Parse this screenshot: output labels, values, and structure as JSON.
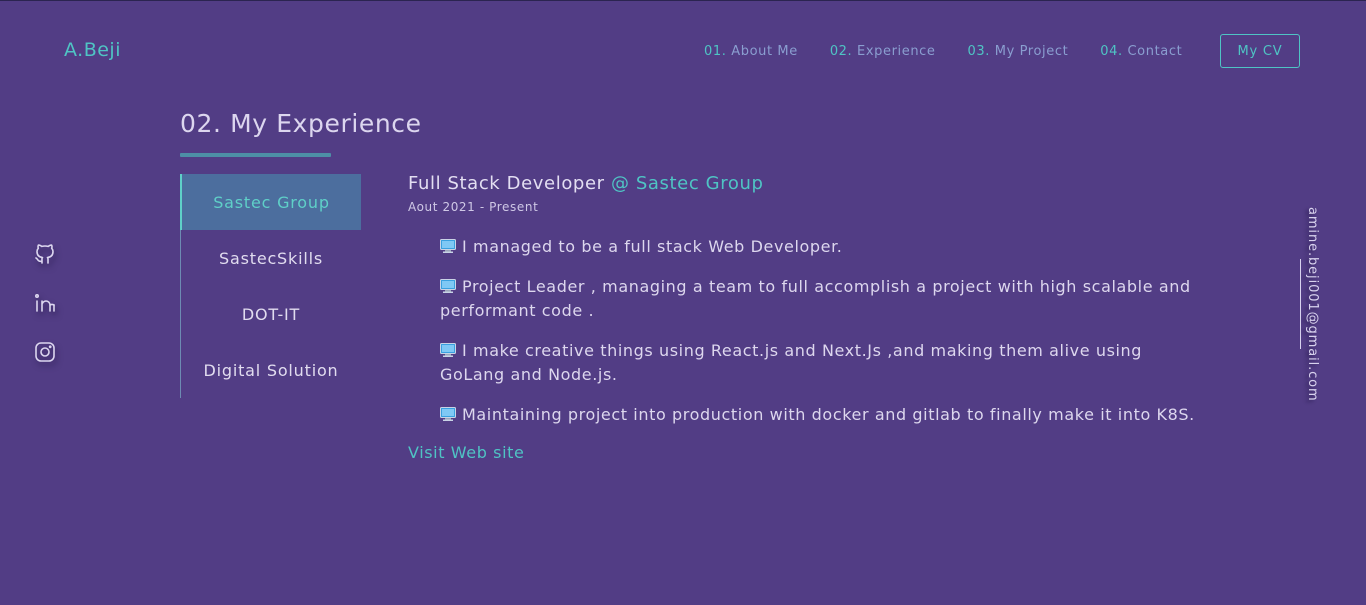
{
  "header": {
    "logo": "A.Beji",
    "nav": [
      {
        "num": "01.",
        "label": "About Me"
      },
      {
        "num": "02.",
        "label": "Experience"
      },
      {
        "num": "03.",
        "label": "My Project"
      },
      {
        "num": "04.",
        "label": "Contact"
      }
    ],
    "cv_label": "My CV"
  },
  "section": {
    "title": "02. My Experience"
  },
  "tabs": [
    {
      "label": "Sastec Group",
      "active": true
    },
    {
      "label": "SastecSkills",
      "active": false
    },
    {
      "label": "DOT-IT",
      "active": false
    },
    {
      "label": "Digital Solution",
      "active": false
    }
  ],
  "job": {
    "role": "Full Stack Developer",
    "company": "@ Sastec Group",
    "dates": "Aout 2021 - Present",
    "duties": [
      "I managed to be a full stack Web Developer.",
      "Project Leader , managing a team to full accomplish a project with high scalable and performant code .",
      "I make creative things using React.js and Next.Js ,and making them alive using GoLang and Node.js.",
      "Maintaining project into production with docker and gitlab to finally make it into K8S."
    ],
    "duty_icon": "computer-icon",
    "visit_label": "Visit Web site"
  },
  "social": [
    "github-icon",
    "linkedin-icon",
    "instagram-icon"
  ],
  "email": "amine.beji001@gmail.com",
  "colors": {
    "background": "#523d85",
    "accent": "#4fc4c4",
    "active_tab": "#4c6e9e"
  }
}
